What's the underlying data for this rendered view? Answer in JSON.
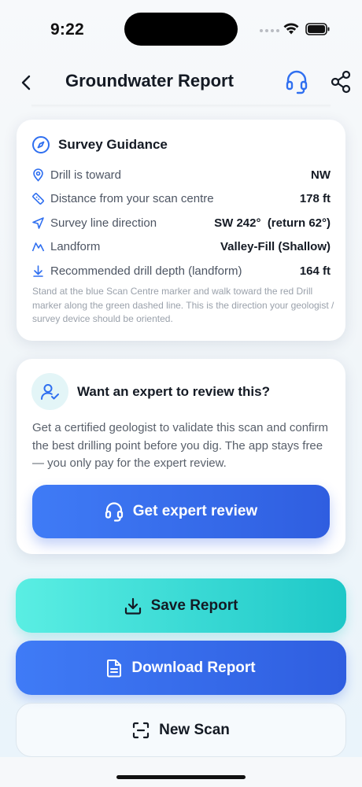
{
  "status_bar": {
    "time": "9:22"
  },
  "header": {
    "title": "Groundwater Report"
  },
  "survey_guidance": {
    "title": "Survey Guidance",
    "rows": [
      {
        "label": "Drill is toward",
        "value": "NW",
        "icon": "location-pin-icon"
      },
      {
        "label": "Distance from your scan centre",
        "value": "178 ft",
        "icon": "ruler-icon"
      },
      {
        "label": "Survey line direction",
        "value": "SW 242°  (return 62°)",
        "icon": "navigation-arrow-icon"
      },
      {
        "label": "Landform",
        "value": "Valley-Fill (Shallow)",
        "icon": "mountain-icon"
      },
      {
        "label": "Recommended drill depth (landform)",
        "value": "164 ft",
        "icon": "arrow-down-icon"
      }
    ],
    "note": "Stand at the blue Scan Centre marker and walk toward the red Drill marker along the green dashed line. This is the direction your geologist / survey device should be oriented."
  },
  "expert": {
    "title": "Want an expert to review this?",
    "description": "Get a certified geologist to validate this scan and confirm the best drilling point before you dig. The app stays free — you only pay for the expert review.",
    "button_label": "Get expert review"
  },
  "actions": {
    "save_label": "Save Report",
    "download_label": "Download Report",
    "new_scan_label": "New Scan"
  },
  "colors": {
    "accent_blue": "#2f6ff0",
    "accent_teal": "#1ec8c8",
    "text_dark": "#141a24",
    "text_muted": "#4d5563"
  }
}
